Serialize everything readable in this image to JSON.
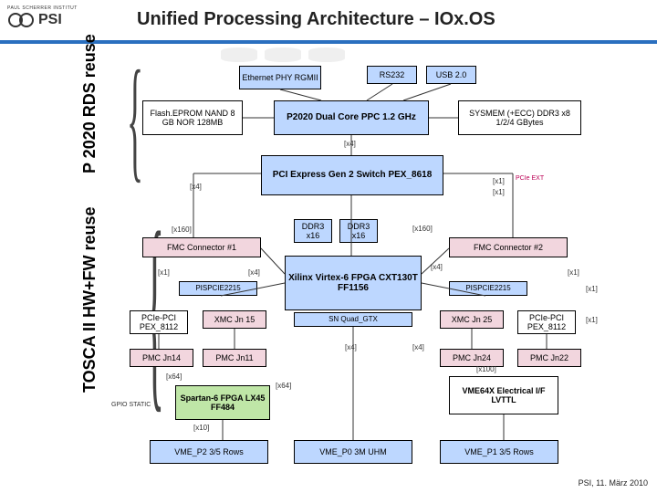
{
  "header": {
    "title": "Unified Processing Architecture – IOx.OS",
    "org_top": "PAUL SCHERRER INSTITUT",
    "org": "PSI"
  },
  "side": {
    "top": "P 2020 RDS reuse",
    "bottom": "TOSCA II HW+FW reuse"
  },
  "nodes": {
    "eth": "Ethernet PHY\nRGMII",
    "rs232": "RS232",
    "usb": "USB 2.0",
    "flash": "Flash.EPROM\nNAND 8 GB\nNOR 128MB",
    "p2020": "P2020\nDual Core PPC 1.2 GHz",
    "sysmem": "SYSMEM (+ECC)\nDDR3 x8\n1/2/4 GBytes",
    "pex": "PCI Express Gen 2\nSwitch\nPEX_8618",
    "fmc1": "FMC Connector #1",
    "fmc2": "FMC Connector #2",
    "ddr3a": "DDR3\nx16",
    "ddr3b": "DDR3\nx16",
    "xilinx": "Xilinx\nVirtex-6 FPGA\nCXT130T\nFF1156",
    "sn_gtx": "SN Quad_GTX",
    "pispcie_l": "PISPCIE2215",
    "pispcie_r": "PISPCIE2215",
    "pcie_pci_l": "PCIe-PCI\nPEX_8112",
    "xmc_l": "XMC Jn 15",
    "xmc_r": "XMC Jn 25",
    "pcie_pci_r": "PCIe-PCI\nPEX_8112",
    "pmc11": "PMC Jn11",
    "pmc14": "PMC Jn14",
    "pmc24": "PMC Jn24",
    "pmc22": "PMC Jn22",
    "spartan": "Spartan-6 FPGA\nLX45\nFF484",
    "vme64x": "VME64X\nElectrical I/F\nLVTTL",
    "vme_p2": "VME_P2\n3/5 Rows",
    "vme_p0": "VME_P0\n3M UHM",
    "vme_p1": "VME_P1\n3/5 Rows"
  },
  "bus": {
    "x4_a": "[x4]",
    "x4_b": "[x4]",
    "x4_c": "[x4]",
    "x4_d": "[x4]",
    "x4_e": "[x4]",
    "x4_f": "[x4]",
    "x1_a": "[x1]",
    "x1_b": "[x1]",
    "x1_c": "[x1]",
    "x1_d": "[x1]",
    "x1_e": "[x1]",
    "x1_f": "[x1]",
    "x160_a": "[x160]",
    "x160_b": "[x160]",
    "x100": "[x100]",
    "x64_a": "[x64]",
    "x64_b": "[x64]",
    "x10": "[x10]",
    "pcie_ext": "PCIe\nEXT",
    "gpio": "GPIO\nSTATIC"
  },
  "footer": "PSI, 11. März 2010"
}
